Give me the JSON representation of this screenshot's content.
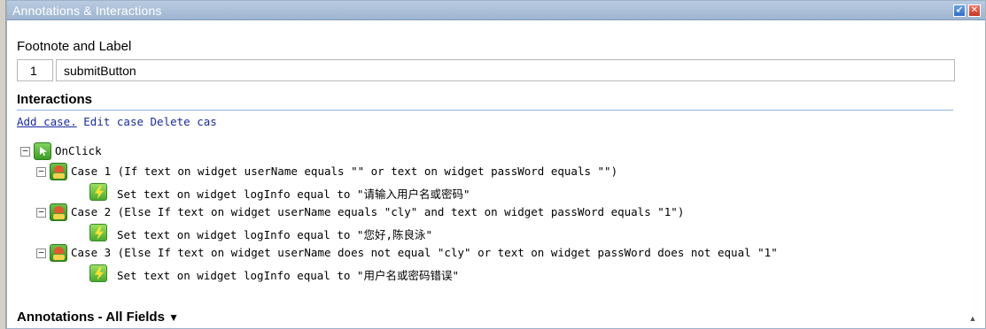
{
  "window": {
    "title": "Annotations & Interactions",
    "restore_glyph": "↙",
    "close_glyph": "✕"
  },
  "footnote": {
    "section_label": "Footnote and Label",
    "number": "1",
    "label": "submitButton"
  },
  "interactions": {
    "heading": "Interactions",
    "actions": {
      "add": "Add case.",
      "edit": "Edit case",
      "delete": "Delete cas"
    },
    "event": {
      "name": "OnClick",
      "cases": [
        {
          "text": "Case 1 (If text on widget userName equals \"\" or text on widget passWord equals \"\")",
          "action": "Set text on widget logInfo equal to \"请输入用户名或密码\""
        },
        {
          "text": "Case 2 (Else If text on widget userName equals \"cly\" and text on widget passWord equals \"1\")",
          "action": "Set text on widget logInfo equal to \"您好,陈良泳\""
        },
        {
          "text": "Case 3 (Else If text on widget userName does not equal \"cly\" or text on widget passWord does not equal \"1\"",
          "action": "Set text on widget logInfo equal to \"用户名或密码错误\""
        }
      ]
    }
  },
  "annotations": {
    "heading": "Annotations - All Fields",
    "toggle_glyph": "▼"
  },
  "icons": {
    "collapse": "minus-box-icon",
    "event": "event-icon",
    "case": "case-icon",
    "action": "lightning-icon"
  }
}
